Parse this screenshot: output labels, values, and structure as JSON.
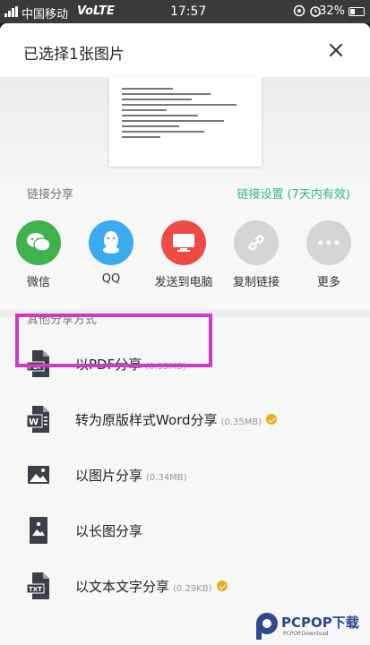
{
  "status_bar": {
    "carrier": "中国移动",
    "network": "VoLTE",
    "time": "17:57",
    "battery": "32%"
  },
  "sheet": {
    "title": "已选择1张图片"
  },
  "link_share": {
    "label": "链接分享",
    "settings_label": "链接设置 (7天内有效)",
    "items": [
      {
        "label": "微信",
        "color": "#3fb14f",
        "icon": "wechat-icon"
      },
      {
        "label": "QQ",
        "color": "#3aabef",
        "icon": "qq-icon"
      },
      {
        "label": "发送到电脑",
        "color": "#ee4a46",
        "icon": "computer-icon"
      },
      {
        "label": "复制链接",
        "color": "#d4d4d4",
        "icon": "link-icon"
      },
      {
        "label": "更多",
        "color": "#d4d4d4",
        "icon": "more-icon"
      }
    ]
  },
  "other_share": {
    "label": "其他分享方式",
    "options": [
      {
        "label": "以PDF分享",
        "size": "(0.35MB)",
        "icon": "pdf-icon",
        "badge": false
      },
      {
        "label": "转为原版样式Word分享",
        "size": "(0.35MB)",
        "icon": "word-icon",
        "badge": true
      },
      {
        "label": "以图片分享",
        "size": "(0.34MB)",
        "icon": "image-icon",
        "badge": false
      },
      {
        "label": "以长图分享",
        "size": "",
        "icon": "long-image-icon",
        "badge": false
      },
      {
        "label": "以文本文字分享",
        "size": "(0.29KB)",
        "icon": "txt-icon",
        "badge": true
      }
    ]
  },
  "watermark": {
    "text": "PCPOP下载",
    "sub": "PCPOP.Download"
  },
  "colors": {
    "accent": "#35b88a",
    "highlight": "#cf38c8",
    "icon_dark": "#3a3f48"
  }
}
